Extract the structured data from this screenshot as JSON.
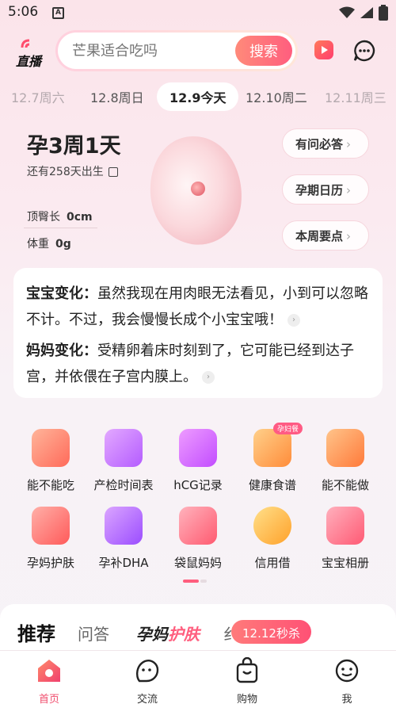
{
  "status": {
    "time": "5:06",
    "app_badge": "A"
  },
  "topbar": {
    "live_label": "直播",
    "search_placeholder": "芒果适合吃吗",
    "search_button": "搜索"
  },
  "dates": [
    {
      "label": "12.7周六",
      "state": "faded"
    },
    {
      "label": "12.8周日",
      "state": "normal"
    },
    {
      "label": "12.9今天",
      "state": "active"
    },
    {
      "label": "12.10周二",
      "state": "normal"
    },
    {
      "label": "12.11周三",
      "state": "faded"
    }
  ],
  "hero": {
    "week": "孕3周1天",
    "due": "还有258天出生",
    "length_label": "顶臀长",
    "length_value": "0cm",
    "weight_label": "体重",
    "weight_value": "0g",
    "buttons": [
      "有问必答",
      "孕期日历",
      "本周要点"
    ]
  },
  "info": {
    "baby_label": "宝宝变化：",
    "baby_text": "虽然我现在用肉眼无法看见，小到可以忽略不计。不过，我会慢慢长成个小宝宝哦！",
    "mom_label": "妈妈变化：",
    "mom_text": "受精卵着床时刻到了，它可能已经到达子宫，并依偎在子宫内膜上。"
  },
  "tools": [
    {
      "label": "能不能吃",
      "icon": "bowl-search-icon",
      "color": "#ff7a6a"
    },
    {
      "label": "产检时间表",
      "icon": "checkup-schedule-icon",
      "color": "#c978ff"
    },
    {
      "label": "hCG记录",
      "icon": "hcg-record-icon",
      "color": "#d96bff"
    },
    {
      "label": "健康食谱",
      "icon": "chef-hat-icon",
      "color": "#ffa64d",
      "badge": "孕妇餐"
    },
    {
      "label": "能不能做",
      "icon": "hand-question-icon",
      "color": "#ff8a4d"
    },
    {
      "label": "孕妈护肤",
      "icon": "skincare-icon",
      "color": "#ff6a6a"
    },
    {
      "label": "孕补DHA",
      "icon": "dha-icon",
      "color": "#b66bff"
    },
    {
      "label": "袋鼠妈妈",
      "icon": "kangaroo-bottle-icon",
      "color": "#ff6a7a"
    },
    {
      "label": "信用借",
      "icon": "credit-coin-icon",
      "color": "#ffae3d"
    },
    {
      "label": "宝宝相册",
      "icon": "photo-album-icon",
      "color": "#ff6a7e"
    }
  ],
  "recommend": {
    "tabs": [
      "推荐",
      "问答"
    ],
    "style_tab_prefix": "孕妈",
    "style_tab_suffix": "护肤",
    "partial_tab": "纟",
    "sale": "12.12秒杀"
  },
  "tabbar": [
    {
      "label": "首页",
      "icon": "home-icon",
      "active": true
    },
    {
      "label": "交流",
      "icon": "community-icon",
      "active": false
    },
    {
      "label": "购物",
      "icon": "shopping-bag-icon",
      "active": false
    },
    {
      "label": "我",
      "icon": "profile-icon",
      "active": false
    }
  ],
  "colors": {
    "accent": "#ff5e7e",
    "tab_active": "#f04e6e"
  }
}
